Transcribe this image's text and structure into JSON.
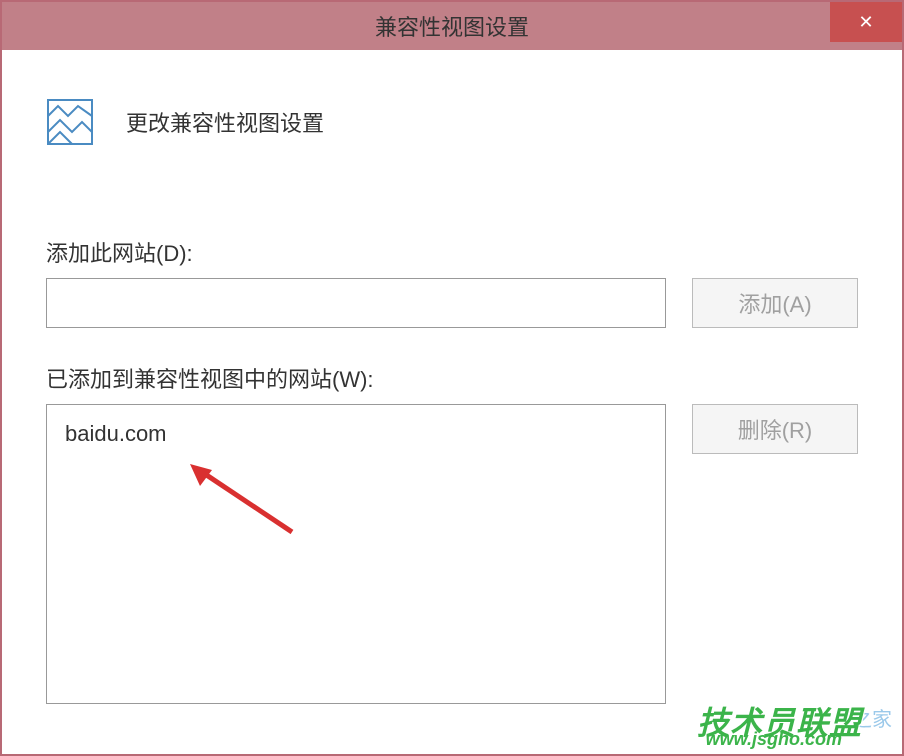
{
  "titlebar": {
    "title": "兼容性视图设置",
    "close": "✕"
  },
  "header": {
    "text": "更改兼容性视图设置"
  },
  "addSection": {
    "label": "添加此网站(D):",
    "inputValue": "",
    "addButton": "添加(A)"
  },
  "listSection": {
    "label": "已添加到兼容性视图中的网站(W):",
    "items": [
      "baidu.com"
    ],
    "removeButton": "删除(R)"
  },
  "watermarks": {
    "brand": "技术员联盟",
    "url": "www.jsgho.com",
    "suffix": "之家"
  }
}
